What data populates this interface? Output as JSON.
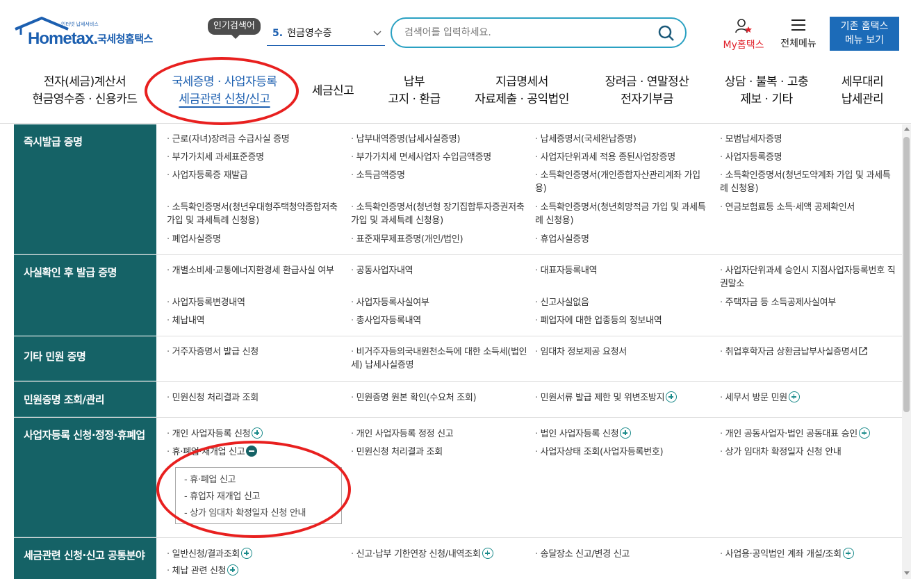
{
  "header": {
    "logo_sub": "인터넷 납세서비스",
    "logo_brand": "Hometax.",
    "logo_name": "국세청홈택스",
    "popular_label": "인기검색어",
    "popular_rank": "5.",
    "popular_term": "현금영수증",
    "search_placeholder": "검색어를 입력하세요.",
    "my_hometax": "My홈택스",
    "all_menu": "전체메뉴",
    "old_hometax_line1": "기존 홈택스",
    "old_hometax_line2": "메뉴 보기"
  },
  "gnb": [
    {
      "l1": "전자(세금)계산서",
      "l2": "현금영수증 · 신용카드"
    },
    {
      "l1": "국세증명 · 사업자등록",
      "l2": "세금관련 신청/신고"
    },
    {
      "l1": "세금신고",
      "l2": ""
    },
    {
      "l1": "납부",
      "l2": "고지 · 환급"
    },
    {
      "l1": "지급명세서",
      "l2": "자료제출 · 공익법인"
    },
    {
      "l1": "장려금 · 연말정산",
      "l2": "전자기부금"
    },
    {
      "l1": "상담 · 불복 · 고충",
      "l2": "제보 · 기타"
    },
    {
      "l1": "세무대리",
      "l2": "납세관리"
    }
  ],
  "categories": [
    {
      "title": "즉시발급 증명",
      "items": [
        "근로(자녀)장려금 수급사실 증명",
        "납부내역증명(납세사실증명)",
        "납세증명서(국세완납증명)",
        "모범납세자증명",
        "부가가치세 과세표준증명",
        "부가가치세 면세사업자 수입금액증명",
        "사업자단위과세 적용 종된사업장증명",
        "사업자등록증명",
        "사업자등록증 재발급",
        "소득금액증명",
        "소득확인증명서(개인종합자산관리계좌 가입용)",
        "소득확인증명서(청년도약계좌 가입 및 과세특례 신청용)",
        "소득확인증명서(청년우대형주택청약종합저축 가입 및 과세특례 신청용)",
        "소득확인증명서(청년형 장기집합투자증권저축 가입 및 과세특례 신청용)",
        "소득확인증명서(청년희망적금 가입 및 과세특례 신청용)",
        "연금보험료등 소득·세액 공제확인서",
        "폐업사실증명",
        "표준재무제표증명(개인/법인)",
        "휴업사실증명"
      ]
    },
    {
      "title": "사실확인 후 발급 증명",
      "items": [
        "개별소비세·교통에너지환경세 환급사실 여부",
        "공동사업자내역",
        "대표자등록내역",
        "사업자단위과세 승인시 지점사업자등록번호 직권말소",
        "사업자등록변경내역",
        "사업자등록사실여부",
        "신고사실없음",
        "주택자금 등 소득공제사실여부",
        "체납내역",
        "총사업자등록내역",
        "폐업자에 대한 업종등의 정보내역"
      ]
    },
    {
      "title": "기타 민원 증명",
      "items": [
        "거주자증명서 발급 신청",
        "비거주자등의국내원천소득에 대한 소득세(법인세) 납세사실증명",
        "임대차 정보제공 요청서",
        "취업후학자금 상환금납부사실증명서"
      ]
    },
    {
      "title": "민원증명 조회/관리",
      "items": [
        "민원신청 처리결과 조회",
        "민원증명 원본 확인(수요처 조회)",
        "민원서류 발급 제한 및 위변조방지",
        "세무서 방문 민원"
      ]
    },
    {
      "title": "사업자등록 신청·정정·휴폐업",
      "items": [
        "개인 사업자등록 신청",
        "개인 사업자등록 정정 신고",
        "법인 사업자등록 신청",
        "개인 공동사업자·법인 공동대표 승인",
        "휴·폐업·재개업 신고",
        "민원신청 처리결과 조회",
        "사업자상태 조회(사업자등록번호)",
        "상가 임대차 확정일자 신청 안내"
      ],
      "submenu": [
        "휴·폐업 신고",
        "휴업자 재개업 신고",
        "상가 임대차 확정일자 신청 안내"
      ]
    },
    {
      "title": "세금관련 신청·신고 공통분야",
      "items": [
        "일반신청/결과조회",
        "신고·납부 기한연장 신청/내역조회",
        "송달장소 신고/변경 신고",
        "사업용·공익법인 계좌 개설/조회",
        "체납 관련 신청"
      ]
    }
  ],
  "colors": {
    "brand": "#1c5fb0",
    "category_bg": "#156266",
    "annotation": "#e8201f",
    "my_red": "#e0202a"
  }
}
